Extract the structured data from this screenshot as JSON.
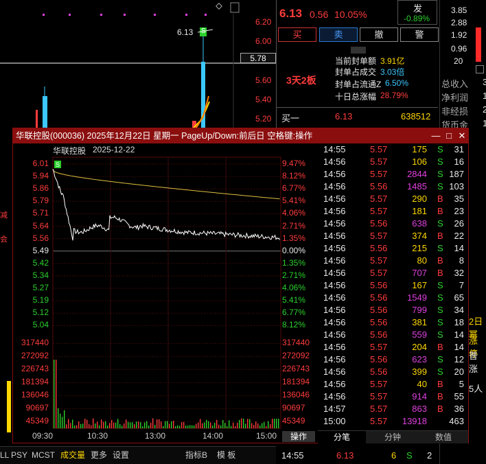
{
  "background": {
    "kline": {
      "price_ticks": [
        "6.20",
        "6.00",
        "5.60",
        "5.40",
        "5.20"
      ],
      "annot_price": "6.13",
      "marker_price": "5.78",
      "b_marker": "B",
      "s_marker": "S"
    },
    "quote": {
      "price": "6.13",
      "change": "0.56",
      "pct": "10.05%",
      "btn_buy": "买",
      "btn_sell": "卖",
      "btn_cancel": "撤",
      "btn_alert": "警",
      "side_label": "发",
      "side_pct": "-0.89%",
      "board_tag": "3天2板",
      "rows": [
        {
          "label": "当前封单额",
          "value": "3.91亿"
        },
        {
          "label": "封单占成交",
          "value": "3.03倍"
        },
        {
          "label": "封单占流通Z",
          "value": "6.50%"
        },
        {
          "label": "十日总涨幅",
          "value": "28.79%"
        }
      ],
      "bid1_label": "买一",
      "bid1_price": "6.13",
      "bid1_vol": "638512",
      "bottom_time": "14:55",
      "bottom_price": "6.13",
      "bottom_vol": "6",
      "bottom_side": "S",
      "bottom_n": "2"
    },
    "right": {
      "nums": [
        "3.85",
        "2.88",
        "1.92",
        "0.96",
        "20"
      ],
      "labels": [
        "总收入",
        "净利润",
        "非经损",
        "货币金"
      ],
      "vals": [
        "3",
        "1",
        "2",
        "1"
      ],
      "extra": [
        "2日幂",
        "涨停",
        "普涨",
        "5人"
      ]
    },
    "left": {
      "labels": [
        "减",
        "会"
      ]
    },
    "bottom_left": [
      "LL",
      "PSY",
      "MCST",
      "成交量",
      "更多",
      "设置"
    ],
    "bottom_mid": [
      "指标B",
      "模 板"
    ]
  },
  "dialog": {
    "title": "华联控股(000036) 2025年12月22日 星期一 PageUp/Down:前后日 空格键:操作",
    "stock_name": "华联控股",
    "date": "2025-12-22",
    "win_minimize": "—",
    "win_restore": "□",
    "win_close": "✕",
    "s_badge": "S",
    "price_ticks": [
      "6.01",
      "5.94",
      "5.86",
      "5.79",
      "5.71",
      "5.64",
      "5.56",
      "5.49",
      "5.42",
      "5.34",
      "5.27",
      "5.19",
      "5.12",
      "5.04"
    ],
    "pct_ticks": [
      "9.47%",
      "8.12%",
      "6.77%",
      "5.41%",
      "4.06%",
      "2.71%",
      "1.35%",
      "0.00%",
      "1.35%",
      "2.71%",
      "4.06%",
      "5.41%",
      "6.77%",
      "8.12%"
    ],
    "vol_ticks": [
      "317440",
      "272092",
      "226743",
      "181394",
      "136046",
      "90697",
      "45349"
    ],
    "time_ticks": [
      "09:30",
      "10:30",
      "13:00",
      "14:00",
      "15:00"
    ],
    "op_label": "操作",
    "tabs": [
      "分笔",
      "分钟",
      "数值"
    ],
    "trades": [
      {
        "t": "14:55",
        "p": "5.57",
        "v": "175",
        "s": "S",
        "n": "31"
      },
      {
        "t": "14:56",
        "p": "5.57",
        "v": "106",
        "s": "S",
        "n": "16"
      },
      {
        "t": "14:56",
        "p": "5.57",
        "v": "2844",
        "s": "S",
        "n": "187"
      },
      {
        "t": "14:56",
        "p": "5.56",
        "v": "1485",
        "s": "S",
        "n": "103"
      },
      {
        "t": "14:56",
        "p": "5.57",
        "v": "290",
        "s": "B",
        "n": "35"
      },
      {
        "t": "14:56",
        "p": "5.57",
        "v": "181",
        "s": "B",
        "n": "23"
      },
      {
        "t": "14:56",
        "p": "5.56",
        "v": "638",
        "s": "S",
        "n": "26"
      },
      {
        "t": "14:56",
        "p": "5.57",
        "v": "374",
        "s": "B",
        "n": "22"
      },
      {
        "t": "14:56",
        "p": "5.56",
        "v": "215",
        "s": "S",
        "n": "14"
      },
      {
        "t": "14:56",
        "p": "5.57",
        "v": "80",
        "s": "B",
        "n": "8"
      },
      {
        "t": "14:56",
        "p": "5.57",
        "v": "707",
        "s": "B",
        "n": "32"
      },
      {
        "t": "14:56",
        "p": "5.56",
        "v": "167",
        "s": "S",
        "n": "7"
      },
      {
        "t": "14:56",
        "p": "5.56",
        "v": "1549",
        "s": "S",
        "n": "65"
      },
      {
        "t": "14:56",
        "p": "5.56",
        "v": "799",
        "s": "S",
        "n": "34"
      },
      {
        "t": "14:56",
        "p": "5.56",
        "v": "381",
        "s": "S",
        "n": "18"
      },
      {
        "t": "14:56",
        "p": "5.56",
        "v": "559",
        "s": "S",
        "n": "14"
      },
      {
        "t": "14:56",
        "p": "5.57",
        "v": "204",
        "s": "B",
        "n": "14"
      },
      {
        "t": "14:56",
        "p": "5.56",
        "v": "623",
        "s": "S",
        "n": "12"
      },
      {
        "t": "14:56",
        "p": "5.56",
        "v": "399",
        "s": "S",
        "n": "20"
      },
      {
        "t": "14:56",
        "p": "5.57",
        "v": "40",
        "s": "B",
        "n": "5"
      },
      {
        "t": "14:56",
        "p": "5.57",
        "v": "914",
        "s": "B",
        "n": "55"
      },
      {
        "t": "14:57",
        "p": "5.57",
        "v": "863",
        "s": "B",
        "n": "36"
      },
      {
        "t": "15:00",
        "p": "5.57",
        "v": "13918",
        "s": "",
        "n": "463"
      }
    ]
  },
  "colors": {
    "up": "#ff3c3c",
    "down": "#2cd12c",
    "price_line": "#ffffff",
    "avg_line": "#e0c040",
    "title_bar": "#8b0e0e"
  }
}
